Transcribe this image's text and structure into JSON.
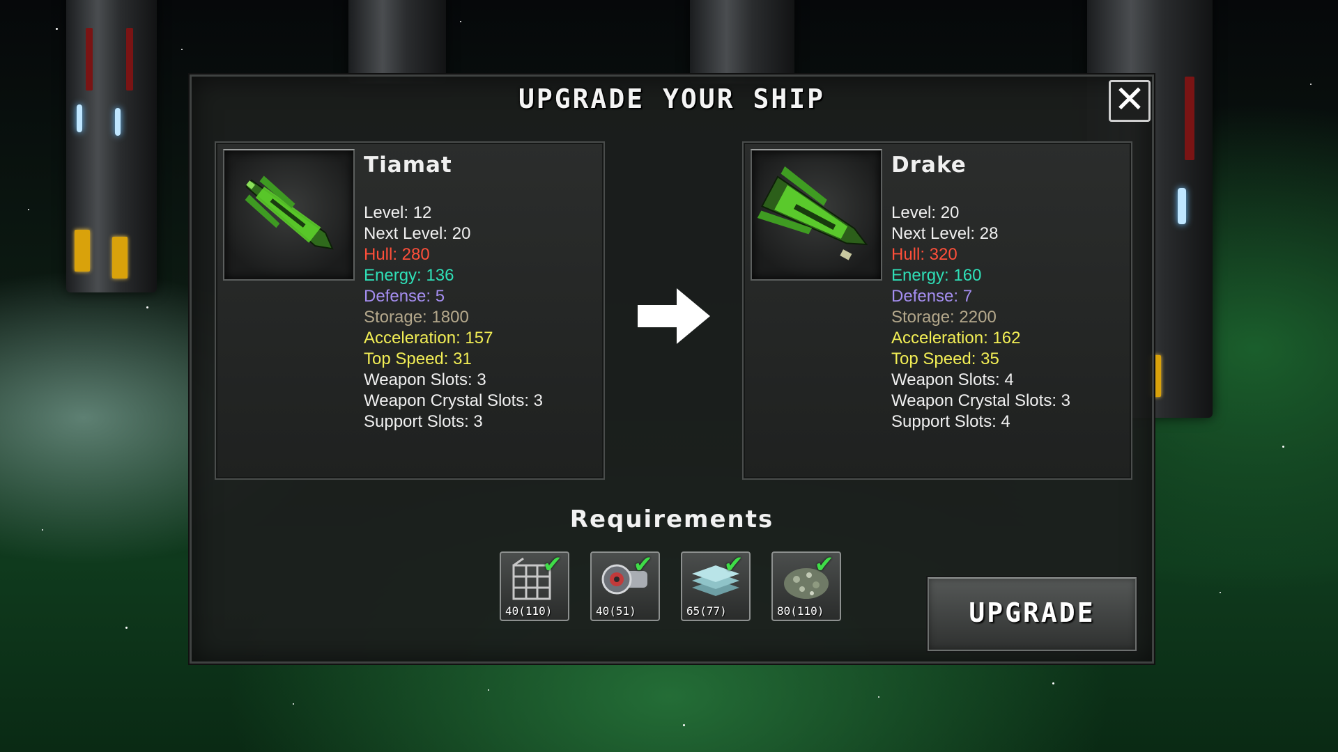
{
  "modal": {
    "title": "UPGRADE YOUR SHIP",
    "close_glyph": "✕"
  },
  "colors": {
    "hull": "#ff4f3a",
    "energy": "#2fe0b8",
    "defense": "#a58ef0",
    "storage": "#b4a88c",
    "acceleration": "#f2ee55",
    "top_speed": "#f2ee55",
    "plain": "#f0f0f0",
    "check": "#3fdc48"
  },
  "current_ship": {
    "name": "Tiamat",
    "stats": {
      "level": "Level: 12",
      "next_level": "Next Level: 20",
      "hull": "Hull: 280",
      "energy": "Energy: 136",
      "defense": "Defense: 5",
      "storage": "Storage: 1800",
      "acceleration": "Acceleration: 157",
      "top_speed": "Top Speed: 31",
      "weapon_slots": "Weapon Slots: 3",
      "weapon_crystal_slots": "Weapon Crystal Slots: 3",
      "support_slots": "Support Slots: 3"
    }
  },
  "next_ship": {
    "name": "Drake",
    "stats": {
      "level": "Level: 20",
      "next_level": "Next Level: 28",
      "hull": "Hull: 320",
      "energy": "Energy: 160",
      "defense": "Defense: 7",
      "storage": "Storage: 2200",
      "acceleration": "Acceleration: 162",
      "top_speed": "Top Speed: 35",
      "weapon_slots": "Weapon Slots: 4",
      "weapon_crystal_slots": "Weapon Crystal Slots: 3",
      "support_slots": "Support Slots: 4"
    }
  },
  "requirements": {
    "title": "Requirements",
    "check_glyph": "✔",
    "items": [
      {
        "icon": "metal-frame-icon",
        "count": "40(110)"
      },
      {
        "icon": "engine-part-icon",
        "count": "40(51)"
      },
      {
        "icon": "crystal-plates-icon",
        "count": "65(77)"
      },
      {
        "icon": "ore-pile-icon",
        "count": "80(110)"
      }
    ]
  },
  "actions": {
    "upgrade_label": "UPGRADE"
  }
}
